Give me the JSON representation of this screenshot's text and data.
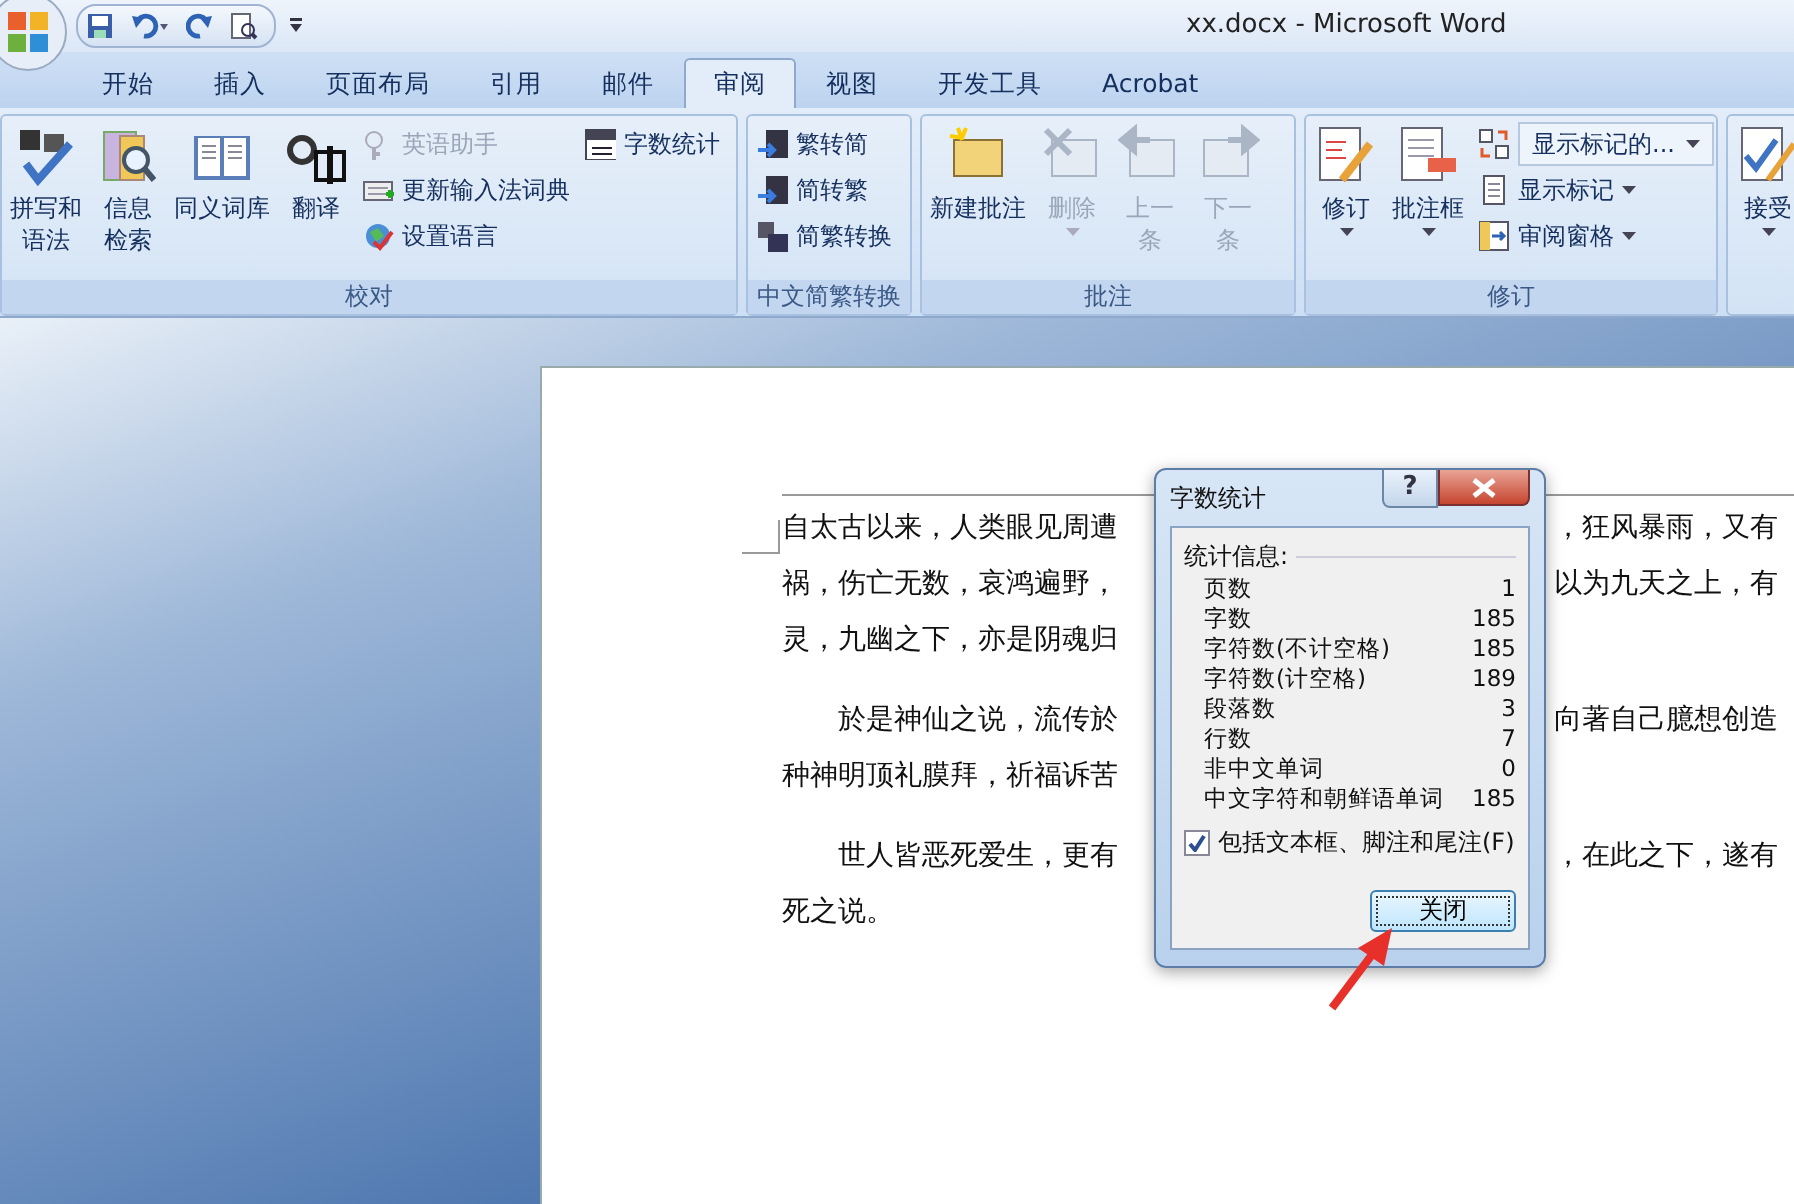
{
  "window": {
    "title": "xx.docx - Microsoft Word"
  },
  "tabs": [
    {
      "label": "开始",
      "selected": false
    },
    {
      "label": "插入",
      "selected": false
    },
    {
      "label": "页面布局",
      "selected": false
    },
    {
      "label": "引用",
      "selected": false
    },
    {
      "label": "邮件",
      "selected": false
    },
    {
      "label": "审阅",
      "selected": true
    },
    {
      "label": "视图",
      "selected": false
    },
    {
      "label": "开发工具",
      "selected": false
    },
    {
      "label": "Acrobat",
      "selected": false
    }
  ],
  "ribbon_groups": [
    {
      "label": "校对",
      "controls": [
        {
          "kind": "large",
          "label": "拼写和语法",
          "disabled": false,
          "menu": false
        },
        {
          "kind": "large",
          "label": "信息检索",
          "disabled": false,
          "menu": false
        },
        {
          "kind": "wide",
          "label": "同义词库",
          "disabled": false,
          "menu": false
        },
        {
          "kind": "wide",
          "label": "翻译",
          "disabled": false,
          "menu": false
        },
        {
          "kind": "small",
          "label": "英语助手",
          "disabled": true,
          "menu": false
        },
        {
          "kind": "small",
          "label": "更新输入法词典",
          "disabled": false,
          "menu": false
        },
        {
          "kind": "small",
          "label": "设置语言",
          "disabled": false,
          "menu": false
        },
        {
          "kind": "small",
          "label": "字数统计",
          "disabled": false,
          "menu": false
        }
      ]
    },
    {
      "label": "中文简繁转换",
      "controls": [
        {
          "kind": "small",
          "label": "繁转简",
          "disabled": false,
          "menu": false
        },
        {
          "kind": "small",
          "label": "简转繁",
          "disabled": false,
          "menu": false
        },
        {
          "kind": "small",
          "label": "简繁转换",
          "disabled": false,
          "menu": false
        }
      ]
    },
    {
      "label": "批注",
      "controls": [
        {
          "kind": "wide",
          "label": "新建批注",
          "disabled": false,
          "menu": false
        },
        {
          "kind": "wide",
          "label": "删除",
          "disabled": true,
          "menu": true
        },
        {
          "kind": "large",
          "label": "上一条",
          "disabled": true,
          "menu": false
        },
        {
          "kind": "large",
          "label": "下一条",
          "disabled": true,
          "menu": false
        }
      ]
    },
    {
      "label": "修订",
      "controls": [
        {
          "kind": "wide",
          "label": "修订",
          "disabled": false,
          "menu": true
        },
        {
          "kind": "wide",
          "label": "批注框",
          "disabled": false,
          "menu": true
        },
        {
          "kind": "combo",
          "label": "显示标记的...",
          "disabled": false,
          "menu": true
        },
        {
          "kind": "small",
          "label": "显示标记",
          "disabled": false,
          "menu": true
        },
        {
          "kind": "small",
          "label": "审阅窗格",
          "disabled": false,
          "menu": true
        }
      ]
    },
    {
      "controls": [
        {
          "kind": "wide",
          "label": "接受",
          "disabled": false,
          "menu": true
        }
      ]
    }
  ],
  "document": {
    "paragraphs": [
      {
        "indent": false,
        "lines": [
          {
            "left": "自太古以来，人类眼见周遭",
            "right": "，狂风暴雨，又有"
          },
          {
            "left": "祸，伤亡无数，哀鸿遍野，",
            "right": "以为九天之上，有"
          },
          {
            "left": "灵，九幽之下，亦是阴魂归"
          }
        ]
      },
      {
        "indent": true,
        "lines": [
          {
            "left": "於是神仙之说，流传於",
            "right": "向著自己臆想创造"
          },
          {
            "left": "种神明顶礼膜拜，祈福诉苦"
          }
        ]
      },
      {
        "indent": true,
        "lines": [
          {
            "left": "世人皆恶死爱生，更有",
            "right": "，在此之下，遂有"
          },
          {
            "left": "死之说。"
          }
        ]
      }
    ]
  },
  "dialog": {
    "title": "字数统计",
    "help": "?",
    "section": "统计信息:",
    "stats": [
      {
        "name": "页数",
        "value": "1"
      },
      {
        "name": "字数",
        "value": "185"
      },
      {
        "name": "字符数(不计空格)",
        "value": "185"
      },
      {
        "name": "字符数(计空格)",
        "value": "189"
      },
      {
        "name": "段落数",
        "value": "3"
      },
      {
        "name": "行数",
        "value": "7"
      },
      {
        "name": "非中文单词",
        "value": "0"
      },
      {
        "name": "中文字符和朝鲜语单词",
        "value": "185"
      }
    ],
    "checkbox": {
      "label": "包括文本框、脚注和尾注(F)",
      "checked": true
    },
    "close_button": "关闭"
  }
}
